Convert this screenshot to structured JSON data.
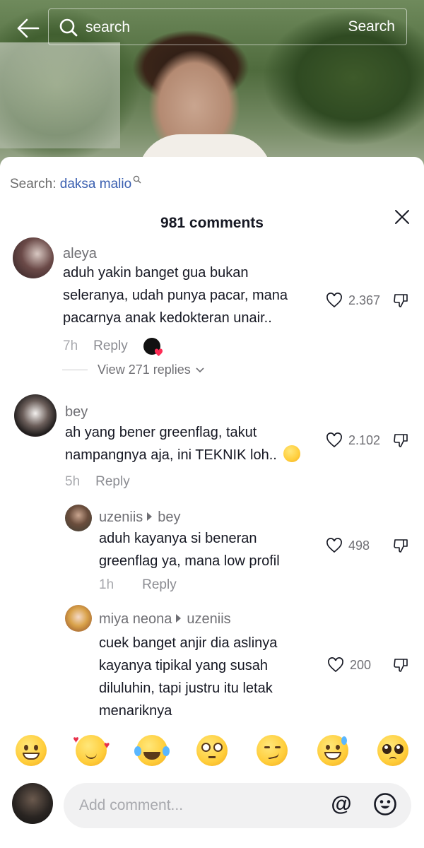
{
  "search": {
    "placeholder": "search",
    "button_label": "Search",
    "hint_prefix": "Search:",
    "hint_term": "daksa malio"
  },
  "comments_header": {
    "title": "981 comments"
  },
  "comments": [
    {
      "username": "aleya",
      "lines": [
        "aduh yakin banget gua bukan",
        "seleranya, udah punya pacar, mana",
        "pacarnya anak kedokteran unair.."
      ],
      "time": "7h",
      "reply_label": "Reply",
      "likes": "2.367",
      "liked_by_creator": true,
      "view_replies": "View 271 replies"
    },
    {
      "username": "bey",
      "lines": [
        "ah yang bener greenflag, takut",
        "nampangnya aja, ini TEKNIK loh.."
      ],
      "time": "5h",
      "reply_label": "Reply",
      "likes": "2.102",
      "trailing_emoji": "pensive-face"
    }
  ],
  "replies": [
    {
      "username": "uzeniis",
      "reply_to": "bey",
      "lines": [
        "aduh kayanya si beneran",
        "greenflag ya, mana low profil"
      ],
      "time": "1h",
      "reply_label": "Reply",
      "likes": "498"
    },
    {
      "username": "miya neona",
      "reply_to": "uzeniis",
      "lines": [
        "cuek banget anjir dia aslinya",
        "kayanya tipikal yang susah",
        "diluluhin, tapi justru itu letak",
        "menariknya"
      ],
      "likes": "200"
    }
  ],
  "emoji_bar": [
    "grinning-face",
    "smiling-face-with-hearts",
    "face-with-tears-of-joy",
    "flushed-face",
    "smirking-face",
    "grinning-face-with-sweat",
    "pleading-face"
  ],
  "composer": {
    "placeholder": "Add comment...",
    "mention_label": "@"
  },
  "colors": {
    "link_blue": "#3a5fb0",
    "text": "#161823",
    "muted": "#6f6f74",
    "input_bg": "#f1f1f2"
  }
}
